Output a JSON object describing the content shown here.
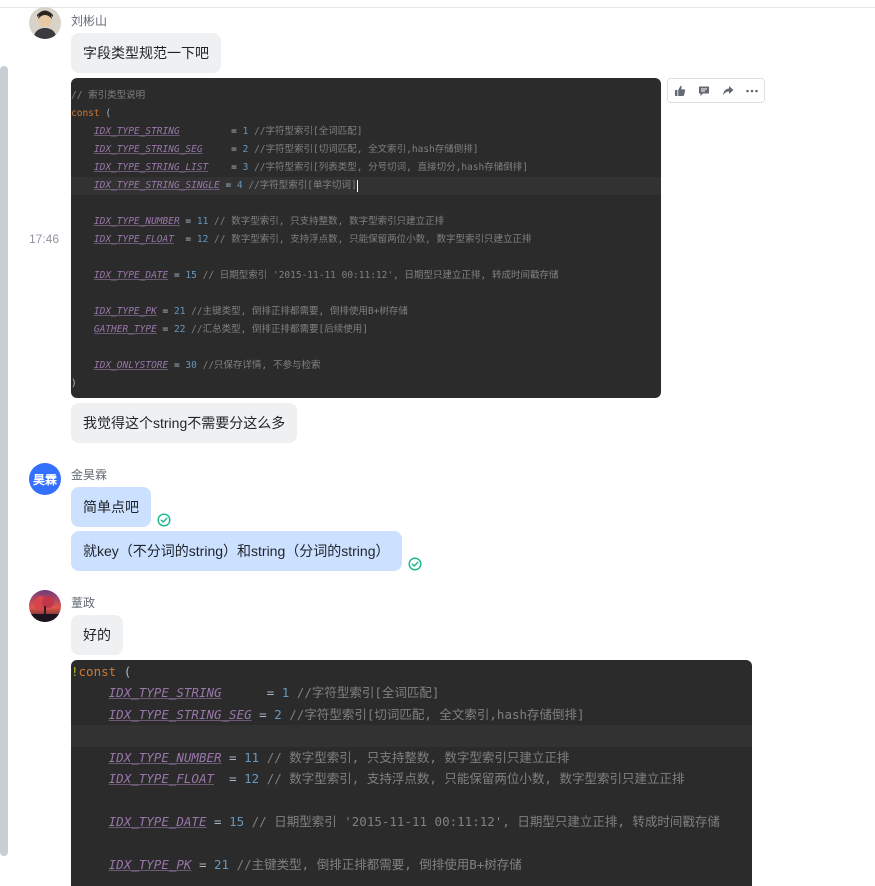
{
  "messages": [
    {
      "sender": "刘彬山",
      "avatar": "person-avatar-1",
      "items": [
        {
          "kind": "text",
          "text": "字段类型规范一下吧"
        },
        {
          "kind": "code-image",
          "timestamp": "17:46"
        },
        {
          "kind": "text",
          "text": "我觉得这个string不需要分这么多"
        }
      ]
    },
    {
      "sender": "金昊霖",
      "avatar_text": "昊霖",
      "items": [
        {
          "kind": "text",
          "text": "简单点吧",
          "read": true
        },
        {
          "kind": "text",
          "text": "就key（不分词的string）和string（分词的string）",
          "read": true
        }
      ]
    },
    {
      "sender": "蕫政",
      "avatar": "sunset-tree-avatar",
      "items": [
        {
          "kind": "text",
          "text": "好的"
        },
        {
          "kind": "code-image"
        }
      ]
    }
  ],
  "code1": {
    "comment": "// 索引类型说明",
    "kw_const": "const",
    "open": " (",
    "close": ")",
    "lines": [
      {
        "name": "IDX_TYPE_STRING",
        "pad": "        ",
        "op": " = ",
        "num": "1",
        "comment": " //字符型索引[全词匹配]"
      },
      {
        "name": "IDX_TYPE_STRING_SEG",
        "pad": "    ",
        "op": " = ",
        "num": "2",
        "comment": " //字符型索引[切词匹配, 全文索引,hash存储倒排]"
      },
      {
        "name": "IDX_TYPE_STRING_LIST",
        "pad": "   ",
        "op": " = ",
        "num": "3",
        "comment": " //字符型索引[列表类型, 分号切词, 直接切分,hash存储倒排]"
      },
      {
        "name": "IDX_TYPE_STRING_SINGLE",
        "pad": "",
        "op": " = ",
        "num": "4",
        "comment": " //字符型索引[单字切词]"
      },
      {
        "name": "IDX_TYPE_NUMBER",
        "pad": "",
        "op": " = ",
        "num": "11",
        "comment": " // 数字型索引, 只支持整数, 数字型索引只建立正排"
      },
      {
        "name": "IDX_TYPE_FLOAT",
        "pad": "  ",
        "op": "= ",
        "num": "12",
        "comment": " // 数字型索引, 支持浮点数, 只能保留两位小数, 数字型索引只建立正排"
      },
      {
        "name": "IDX_TYPE_DATE",
        "pad": "",
        "op": " = ",
        "num": "15",
        "comment": " // 日期型索引 '2015-11-11 00:11:12', 日期型只建立正排, 转成时间戳存储"
      },
      {
        "name": "IDX_TYPE_PK",
        "pad": "",
        "op": " = ",
        "num": "21",
        "comment": " //主键类型, 倒排正排都需要, 倒排使用B+树存储"
      },
      {
        "name": "GATHER_TYPE",
        "pad": "",
        "op": " = ",
        "num": "22",
        "comment": " //汇总类型, 倒排正排都需要[后续使用]"
      },
      {
        "name": "IDX_ONLYSTORE",
        "pad": "",
        "op": " = ",
        "num": "30",
        "comment": " //只保存详情, 不参与检索"
      }
    ]
  },
  "code2": {
    "kw_const": "const",
    "open": " (",
    "lines": [
      {
        "name": "IDX_TYPE_STRING",
        "pad": "     ",
        "op": " = ",
        "num": "1",
        "comment": " //字符型索引[全词匹配]"
      },
      {
        "name": "IDX_TYPE_STRING_SEG",
        "pad": "",
        "op": " = ",
        "num": "2",
        "comment": " //字符型索引[切词匹配, 全文索引,hash存储倒排]"
      },
      {
        "name": "IDX_TYPE_NUMBER",
        "pad": "",
        "op": " = ",
        "num": "11",
        "comment": " // 数字型索引, 只支持整数, 数字型索引只建立正排"
      },
      {
        "name": "IDX_TYPE_FLOAT",
        "pad": "  ",
        "op": "= ",
        "num": "12",
        "comment": " // 数字型索引, 支持浮点数, 只能保留两位小数, 数字型索引只建立正排"
      },
      {
        "name": "IDX_TYPE_DATE",
        "pad": "",
        "op": " = ",
        "num": "15",
        "comment": " // 日期型索引 '2015-11-11 00:11:12', 日期型只建立正排, 转成时间戳存储"
      },
      {
        "name": "IDX_TYPE_PK",
        "pad": "",
        "op": " = ",
        "num": "21",
        "comment": " //主键类型, 倒排正排都需要, 倒排使用B+树存储"
      }
    ]
  },
  "toolbar": {
    "buttons": [
      "thumbs-up-icon",
      "reply-icon",
      "forward-icon",
      "more-icon"
    ]
  },
  "colors": {
    "bubble_gray": "#eff0f1",
    "bubble_blue": "#cce0ff",
    "read_check": "#14b88a",
    "avatar_blue": "#3370ff",
    "code_bg": "#2b2b2b"
  }
}
